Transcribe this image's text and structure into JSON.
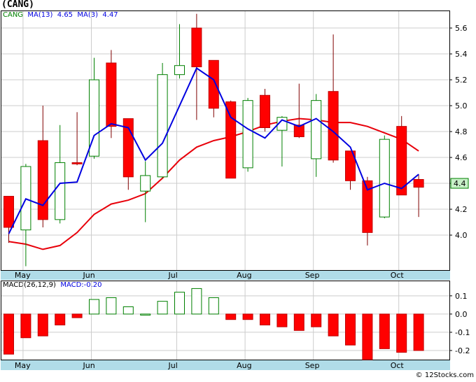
{
  "title": "(CANG)",
  "legend": {
    "ticker": "CANG",
    "ma13_label": "MA(13)",
    "ma13_value": "4.65",
    "ma3_label": "MA(3)",
    "ma3_value": "4.47",
    "macd_label": "MACD(26,12,9)",
    "macd_value": "MACD:-0.20"
  },
  "credit": "© 12Stocks.com",
  "colors": {
    "up_candle": "#008000",
    "down_candle": "#ff0000",
    "ma13": "#e8000a",
    "ma3": "#0000e0",
    "band": "#b0dce8",
    "grid": "#cccccc"
  },
  "chart_data": [
    {
      "type": "candlestick",
      "y_axis": {
        "ticks": [
          "4.0",
          "4.2",
          "4.4",
          "4.6",
          "4.8",
          "5.0",
          "5.2",
          "5.4",
          "5.6"
        ],
        "range": [
          3.73,
          5.73
        ]
      },
      "x_axis": {
        "labels": [
          "May",
          "Jun",
          "Jul",
          "Aug",
          "Sep",
          "Oct"
        ]
      },
      "last_price_label": "4.4",
      "last_price": 4.4,
      "candles": [
        {
          "o": 4.3,
          "h": 4.3,
          "l": 3.94,
          "c": 4.06
        },
        {
          "o": 4.04,
          "h": 4.55,
          "l": 3.76,
          "c": 4.53
        },
        {
          "o": 4.73,
          "h": 5.0,
          "l": 4.06,
          "c": 4.12
        },
        {
          "o": 4.12,
          "h": 4.85,
          "l": 4.09,
          "c": 4.56
        },
        {
          "o": 4.56,
          "h": 4.95,
          "l": 4.54,
          "c": 4.55
        },
        {
          "o": 4.61,
          "h": 5.37,
          "l": 4.59,
          "c": 5.2
        },
        {
          "o": 5.33,
          "h": 5.43,
          "l": 4.75,
          "c": 4.84
        },
        {
          "o": 4.9,
          "h": 4.9,
          "l": 4.35,
          "c": 4.45
        },
        {
          "o": 4.34,
          "h": 4.57,
          "l": 4.1,
          "c": 4.46
        },
        {
          "o": 4.45,
          "h": 5.33,
          "l": 4.44,
          "c": 5.24
        },
        {
          "o": 5.24,
          "h": 5.63,
          "l": 5.21,
          "c": 5.31
        },
        {
          "o": 5.6,
          "h": 5.71,
          "l": 4.89,
          "c": 5.3
        },
        {
          "o": 5.35,
          "h": 5.35,
          "l": 4.91,
          "c": 4.98
        },
        {
          "o": 5.03,
          "h": 5.04,
          "l": 4.44,
          "c": 4.44
        },
        {
          "o": 4.52,
          "h": 5.06,
          "l": 4.49,
          "c": 5.04
        },
        {
          "o": 5.08,
          "h": 5.13,
          "l": 4.8,
          "c": 4.83
        },
        {
          "o": 4.81,
          "h": 4.92,
          "l": 4.53,
          "c": 4.91
        },
        {
          "o": 4.85,
          "h": 5.17,
          "l": 4.75,
          "c": 4.76
        },
        {
          "o": 4.59,
          "h": 5.09,
          "l": 4.45,
          "c": 5.04
        },
        {
          "o": 5.11,
          "h": 5.55,
          "l": 4.56,
          "c": 4.58
        },
        {
          "o": 4.65,
          "h": 4.65,
          "l": 4.35,
          "c": 4.42
        },
        {
          "o": 4.42,
          "h": 4.45,
          "l": 3.92,
          "c": 4.02
        },
        {
          "o": 4.14,
          "h": 4.77,
          "l": 4.13,
          "c": 4.74
        },
        {
          "o": 4.84,
          "h": 4.92,
          "l": 4.31,
          "c": 4.31
        },
        {
          "o": 4.43,
          "h": 4.47,
          "l": 4.14,
          "c": 4.37
        }
      ],
      "ma13": [
        {
          "i": 0,
          "v": 3.95
        },
        {
          "i": 1,
          "v": 3.93
        },
        {
          "i": 2,
          "v": 3.89
        },
        {
          "i": 3,
          "v": 3.92
        },
        {
          "i": 4,
          "v": 4.02
        },
        {
          "i": 5,
          "v": 4.16
        },
        {
          "i": 6,
          "v": 4.24
        },
        {
          "i": 7,
          "v": 4.27
        },
        {
          "i": 8,
          "v": 4.32
        },
        {
          "i": 9,
          "v": 4.44
        },
        {
          "i": 10,
          "v": 4.58
        },
        {
          "i": 11,
          "v": 4.68
        },
        {
          "i": 12,
          "v": 4.73
        },
        {
          "i": 13,
          "v": 4.76
        },
        {
          "i": 14,
          "v": 4.8
        },
        {
          "i": 15,
          "v": 4.85
        },
        {
          "i": 16,
          "v": 4.88
        },
        {
          "i": 17,
          "v": 4.9
        },
        {
          "i": 18,
          "v": 4.89
        },
        {
          "i": 19,
          "v": 4.87
        },
        {
          "i": 20,
          "v": 4.87
        },
        {
          "i": 21,
          "v": 4.84
        },
        {
          "i": 22,
          "v": 4.79
        },
        {
          "i": 23,
          "v": 4.74
        },
        {
          "i": 24,
          "v": 4.65
        }
      ],
      "ma3": [
        {
          "i": 0,
          "v": 4.01
        },
        {
          "i": 1,
          "v": 4.28
        },
        {
          "i": 2,
          "v": 4.23
        },
        {
          "i": 3,
          "v": 4.4
        },
        {
          "i": 4,
          "v": 4.41
        },
        {
          "i": 5,
          "v": 4.77
        },
        {
          "i": 6,
          "v": 4.86
        },
        {
          "i": 7,
          "v": 4.83
        },
        {
          "i": 8,
          "v": 4.58
        },
        {
          "i": 9,
          "v": 4.71
        },
        {
          "i": 10,
          "v": 5.0
        },
        {
          "i": 11,
          "v": 5.29
        },
        {
          "i": 12,
          "v": 5.2
        },
        {
          "i": 13,
          "v": 4.91
        },
        {
          "i": 14,
          "v": 4.82
        },
        {
          "i": 15,
          "v": 4.75
        },
        {
          "i": 16,
          "v": 4.89
        },
        {
          "i": 17,
          "v": 4.84
        },
        {
          "i": 18,
          "v": 4.9
        },
        {
          "i": 19,
          "v": 4.8
        },
        {
          "i": 20,
          "v": 4.68
        },
        {
          "i": 21,
          "v": 4.35
        },
        {
          "i": 22,
          "v": 4.4
        },
        {
          "i": 23,
          "v": 4.36
        },
        {
          "i": 24,
          "v": 4.47
        }
      ]
    },
    {
      "type": "bar",
      "y_axis": {
        "ticks": [
          "0.1",
          "0.0",
          "-0.1",
          "-0.2"
        ],
        "range": [
          -0.25,
          0.18
        ]
      },
      "x_axis": {
        "labels": [
          "May",
          "Jun",
          "Jul",
          "Aug",
          "Sep",
          "Oct"
        ]
      },
      "values": [
        -0.22,
        -0.13,
        -0.12,
        -0.06,
        -0.02,
        0.08,
        0.09,
        0.04,
        0.0,
        0.07,
        0.12,
        0.14,
        0.09,
        -0.03,
        -0.03,
        -0.06,
        -0.07,
        -0.09,
        -0.07,
        -0.12,
        -0.17,
        -0.25,
        -0.19,
        -0.21,
        -0.2
      ]
    }
  ]
}
